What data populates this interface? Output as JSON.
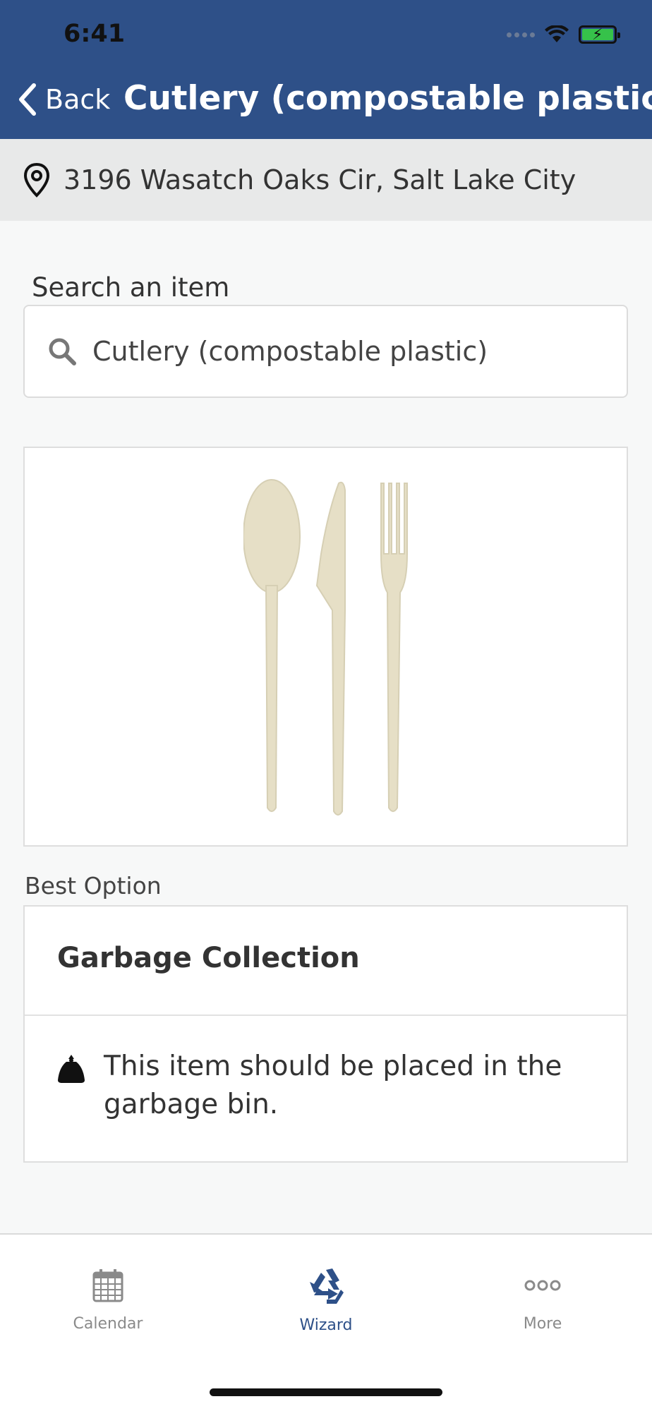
{
  "status": {
    "time": "6:41"
  },
  "nav": {
    "back_label": "Back",
    "title": "Cutlery (compostable plastic)"
  },
  "location": {
    "address": "3196 Wasatch Oaks Cir, Salt Lake City",
    "icon": "location-pin-icon"
  },
  "search": {
    "label": "Search an item",
    "value": "Cutlery (compostable plastic)",
    "icon": "search-icon"
  },
  "item_image": {
    "subject": "compostable plastic spoon, knife and fork"
  },
  "best_option": {
    "label": "Best Option",
    "title": "Garbage Collection",
    "description": "This item should be placed in the garbage bin.",
    "icon": "garbage-bag-icon"
  },
  "tabs": [
    {
      "label": "Calendar",
      "icon": "calendar-icon",
      "active": false
    },
    {
      "label": "Wizard",
      "icon": "recycle-icon",
      "active": true
    },
    {
      "label": "More",
      "icon": "more-icon",
      "active": false
    }
  ],
  "colors": {
    "header": "#2e5088",
    "active_tab": "#2e5088",
    "inactive_tab": "#8a8a8a",
    "battery": "#36c24a"
  }
}
